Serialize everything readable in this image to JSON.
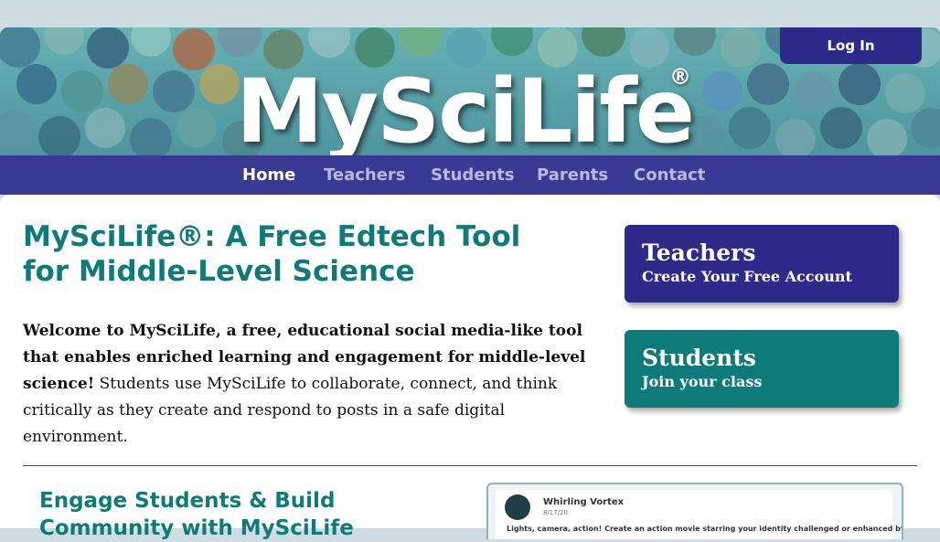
{
  "header": {
    "logo_text": "MySciLife",
    "logo_mark": "®",
    "login_label": "Log In"
  },
  "nav": {
    "items": [
      {
        "label": "Home",
        "active": true
      },
      {
        "label": "Teachers",
        "active": false
      },
      {
        "label": "Students",
        "active": false
      },
      {
        "label": "Parents",
        "active": false
      },
      {
        "label": "Contact",
        "active": false
      }
    ]
  },
  "main": {
    "title": "MySciLife®: A Free Edtech Tool for Middle-Level Science",
    "intro_bold": "Welcome to MySciLife, a free, educational social media-like tool that enables enriched learning and engagement for middle-level science!",
    "intro_text": "Students use MySciLife to collaborate, connect, and think critically as they create and respond to posts in a safe digital environment.",
    "section_title": "Engage Students & Build Community with MySciLife"
  },
  "cards": {
    "teachers": {
      "title": "Teachers",
      "subtitle": "Create Your Free Account"
    },
    "students": {
      "title": "Students",
      "subtitle": "Join your class"
    }
  },
  "preview": {
    "name": "Whirling Vortex",
    "date": "8/17/20",
    "text": "Lights, camera, action! Create an action movie starring your identity challenged or enhanced by"
  },
  "colors": {
    "brand_purple": "#2e2a8a",
    "brand_teal": "#0f7b79",
    "nav_bg": "#3a3a95"
  }
}
